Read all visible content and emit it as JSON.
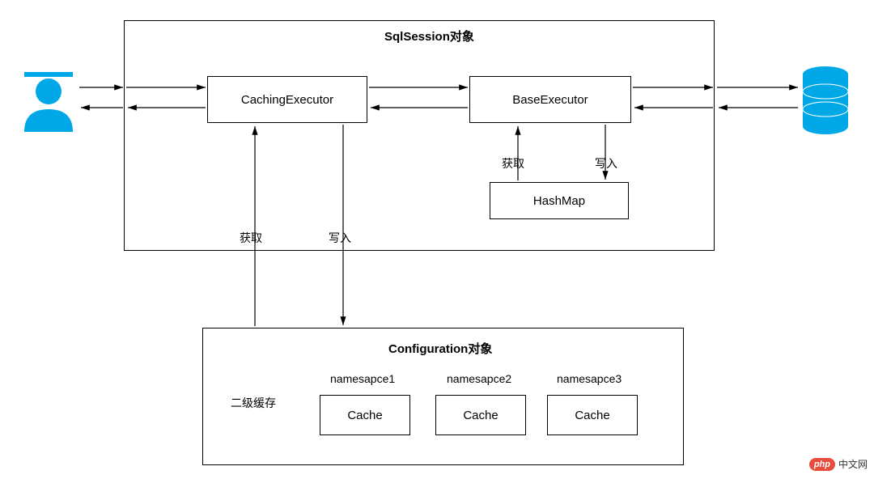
{
  "sqlSession": {
    "title": "SqlSession对象",
    "cachingExecutor": "CachingExecutor",
    "baseExecutor": "BaseExecutor",
    "hashMap": "HashMap",
    "getLabel": "获取",
    "writeLabel": "写入"
  },
  "configuration": {
    "title": "Configuration对象",
    "secondaryCache": "二级缓存",
    "namespaces": [
      "namesapce1",
      "namesapce2",
      "namesapce3"
    ],
    "cacheLabel": "Cache"
  },
  "midLabels": {
    "get": "获取",
    "write": "写入"
  },
  "watermark": {
    "badge": "php",
    "text": "中文网"
  }
}
